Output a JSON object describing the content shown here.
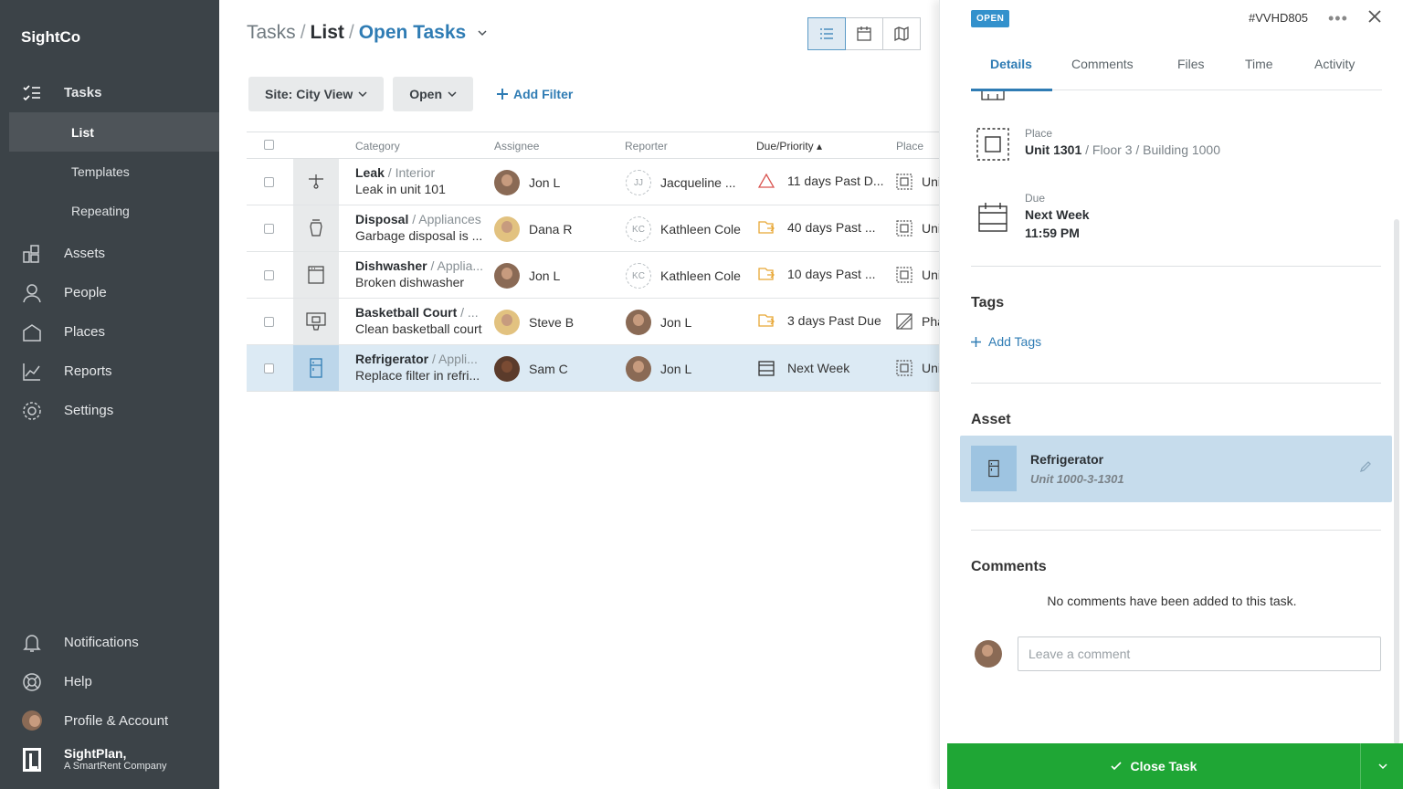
{
  "app": {
    "brand": "SightCo"
  },
  "sidebar": {
    "items": [
      {
        "label": "Tasks",
        "icon": "tasks-icon"
      },
      {
        "label": "List"
      },
      {
        "label": "Templates"
      },
      {
        "label": "Repeating"
      },
      {
        "label": "Assets",
        "icon": "assets-icon"
      },
      {
        "label": "People",
        "icon": "person-icon"
      },
      {
        "label": "Places",
        "icon": "house-icon"
      },
      {
        "label": "Reports",
        "icon": "chart-icon"
      },
      {
        "label": "Settings",
        "icon": "gear-icon"
      }
    ],
    "bottom": [
      {
        "label": "Notifications",
        "icon": "bell-icon"
      },
      {
        "label": "Help",
        "icon": "lifebuoy-icon"
      },
      {
        "label": "Profile & Account",
        "icon": "avatar"
      }
    ],
    "company_line1": "SightPlan,",
    "company_line2": "A SmartRent Company"
  },
  "breadcrumb": {
    "root": "Tasks",
    "sep": "/",
    "level": "List",
    "view": "Open Tasks"
  },
  "filters": {
    "site": "Site: City View",
    "status": "Open",
    "add_filter": "Add Filter"
  },
  "table": {
    "headers": {
      "category": "Category",
      "assignee": "Assignee",
      "reporter": "Reporter",
      "due": "Due/Priority ▴",
      "place": "Place"
    },
    "rows": [
      {
        "cat": "Leak",
        "sub": " / Interior",
        "desc": "Leak in unit 101",
        "assignee": "Jon L",
        "reporter": "Jacqueline ...",
        "reporter_initials": "JJ",
        "due": "11 days Past D...",
        "place": "Unit"
      },
      {
        "cat": "Disposal",
        "sub": " / Appliances",
        "desc": "Garbage disposal is ...",
        "assignee": "Dana R",
        "reporter": "Kathleen Cole",
        "reporter_initials": "KC",
        "due": "40 days Past ...",
        "place": "Unit"
      },
      {
        "cat": "Dishwasher",
        "sub": " / Applia...",
        "desc": "Broken dishwasher",
        "assignee": "Jon L",
        "reporter": "Kathleen Cole",
        "reporter_initials": "KC",
        "due": "10 days Past ...",
        "place": "Unit"
      },
      {
        "cat": "Basketball Court",
        "sub": " / ...",
        "desc": "Clean basketball court",
        "assignee": "Steve B",
        "reporter": "Jon L",
        "reporter_initials": "",
        "due": "3 days Past Due",
        "place": "Pha"
      },
      {
        "cat": "Refrigerator",
        "sub": " / Appli...",
        "desc": "Replace filter in refri...",
        "assignee": "Sam C",
        "reporter": "Jon L",
        "reporter_initials": "",
        "due": "Next Week",
        "place": "Unit"
      }
    ]
  },
  "panel": {
    "status_badge": "OPEN",
    "task_id": "#VVHD805",
    "tabs": [
      "Details",
      "Comments",
      "Files",
      "Time",
      "Activity"
    ],
    "place_label": "Place",
    "place_unit": "Unit 1301",
    "place_rest": " / Floor 3 / Building 1000",
    "due_label": "Due",
    "due_value": "Next Week",
    "due_time": "11:59 PM",
    "tags_title": "Tags",
    "add_tags": "Add Tags",
    "asset_title": "Asset",
    "asset_name": "Refrigerator",
    "asset_sub": "Unit 1000-3-1301",
    "comments_title": "Comments",
    "no_comments": "No comments have been added to this task.",
    "comment_placeholder": "Leave a comment",
    "close_task": "Close Task"
  },
  "colors": {
    "accent": "#2f7cb4",
    "sidebar": "#3c4348",
    "success": "#1fa635",
    "warning": "#e8a735",
    "danger": "#d9534f"
  }
}
